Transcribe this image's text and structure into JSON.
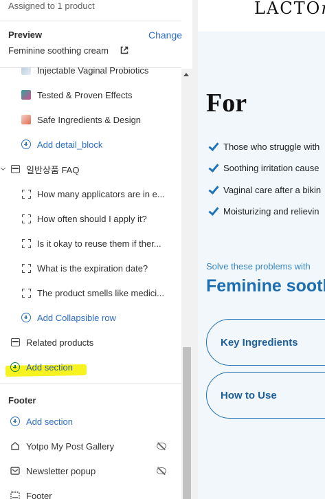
{
  "sidebar": {
    "assigned_text": "Assigned to 1 product",
    "preview": {
      "heading": "Preview",
      "change_label": "Change",
      "product_name": "Feminine soothing cream"
    },
    "blocks": [
      {
        "label": "Injectable Vaginal Probiotics",
        "icon": "image-thumb-icon"
      },
      {
        "label": "Tested & Proven Effects",
        "icon": "image-thumb-icon"
      },
      {
        "label": "Safe Ingredients & Design",
        "icon": "image-thumb-icon"
      }
    ],
    "add_detail_block": "Add detail_block",
    "faq_section": {
      "label": "일반상품 FAQ",
      "rows": [
        "How many applicators are in e...",
        "How often should I apply it?",
        "Is it okay to reuse them if ther...",
        "What is the expiration date?",
        "The product smells like medici..."
      ],
      "add_row": "Add Collapsible row"
    },
    "related_products": "Related products",
    "add_section": "Add section",
    "highlight_color": "#f6f320",
    "footer": {
      "heading": "Footer",
      "add_section": "Add section",
      "items": [
        {
          "label": "Yotpo My Post Gallery",
          "hidden": true
        },
        {
          "label": "Newsletter popup",
          "hidden": true
        },
        {
          "label": "Footer",
          "hidden": false
        }
      ]
    }
  },
  "preview": {
    "brand": "LACTO",
    "brand_italic": "m",
    "heading": "For",
    "checklist": [
      "Those who struggle with",
      "Soothing irritation cause",
      "Vaginal care after a bikin",
      "Moisturizing and relievin"
    ],
    "solve_text": "Solve these problems with",
    "product_title": "Feminine sooth",
    "buttons": [
      "Key Ingredients",
      "How to Use"
    ],
    "accent_color": "#1e6fb2"
  }
}
